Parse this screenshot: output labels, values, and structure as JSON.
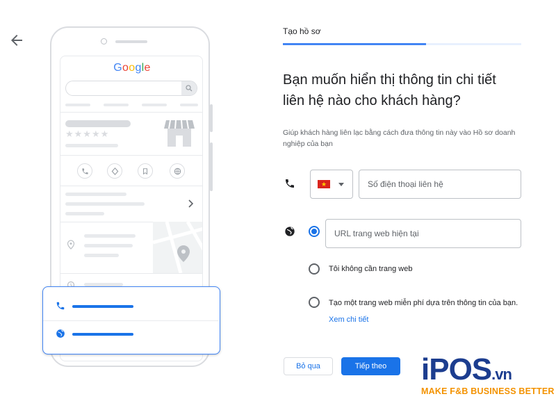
{
  "header": {
    "step_label": "Tạo hồ sơ",
    "progress_percent": 60
  },
  "mockup": {
    "google_logo": "Google",
    "rating_stars": "★★★★★"
  },
  "form": {
    "headline_line1": "Bạn muốn hiển thị thông tin chi tiết",
    "headline_line2": "liên hệ nào cho khách hàng?",
    "helper_text": "Giúp khách hàng liên lạc bằng cách đưa thông tin này vào Hồ sơ doanh nghiệp của bạn",
    "phone_placeholder": "Số điện thoại liên hệ",
    "country_flag_icon": "vietnam-flag",
    "website_options": [
      {
        "label": "URL trang web hiện tại",
        "selected": true
      },
      {
        "label": "Tôi không cần trang web",
        "selected": false
      },
      {
        "label": "Tạo một trang web miễn phí dựa trên thông tin của bạn.",
        "selected": false
      }
    ],
    "learn_more": "Xem chi tiết"
  },
  "buttons": {
    "skip": "Bỏ qua",
    "next": "Tiếp theo"
  },
  "brand": {
    "logo_main": "iPOS",
    "logo_domain": ".vn",
    "tagline": "MAKE F&B BUSINESS BETTER",
    "primary_color": "#1a73e8",
    "logo_blue": "#1c3d8f",
    "logo_orange": "#f39200"
  }
}
